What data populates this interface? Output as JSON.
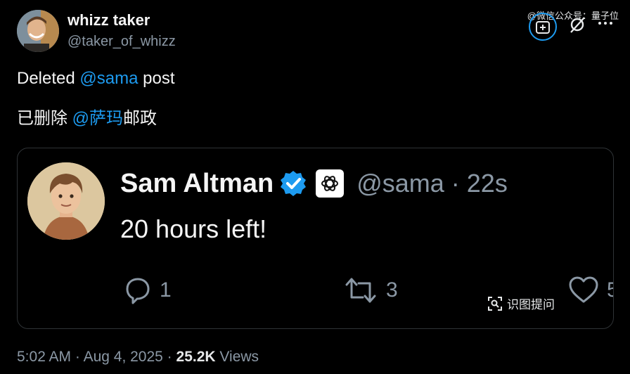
{
  "post": {
    "author_name": "whizz taker",
    "author_handle": "@taker_of_whizz",
    "text_en": {
      "prefix": "Deleted ",
      "mention": "@sama",
      "suffix": " post"
    },
    "text_zh": {
      "prefix": "已删除 ",
      "mention": "@萨玛",
      "suffix": "邮政"
    },
    "time": "5:02 AM",
    "sep1": " · ",
    "date": "Aug 4, 2025",
    "sep2": " · ",
    "views_count": "25.2K",
    "views_label": " Views"
  },
  "quoted": {
    "name": "Sam Altman",
    "handle_time": "@sama · 22s",
    "text": "20 hours left!",
    "reply_count": "1",
    "retweet_count": "3",
    "like_count": "5"
  },
  "overlay": {
    "watermark": "@微信公众号：量子位",
    "recognize_label": "识图提问"
  },
  "icons": [
    "grok-icon",
    "grok-alt-icon",
    "more-icon",
    "verified-icon",
    "openai-logo-icon",
    "reply-icon",
    "retweet-icon",
    "like-icon",
    "scan-icon"
  ],
  "colors": {
    "accent": "#1d9bf0",
    "muted": "#8b98a5",
    "background": "#000000"
  }
}
